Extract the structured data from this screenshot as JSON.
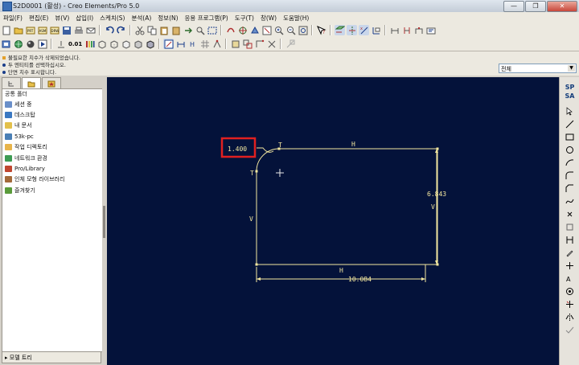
{
  "window": {
    "title": "S2D0001 (활성) - Creo Elements/Pro 5.0",
    "buttons": [
      "—",
      "❐",
      "✕"
    ]
  },
  "menu": [
    "파일(F)",
    "편집(E)",
    "뷰(V)",
    "삽입(I)",
    "스케치(S)",
    "분석(A)",
    "정보(N)",
    "응용 프로그램(P)",
    "도구(T)",
    "창(W)",
    "도움말(H)"
  ],
  "toolbar": {
    "dim_label": "0.01"
  },
  "messages": [
    "불필요한 치수가 삭제되었습니다.",
    "두 엔티티를 선택하십시오.",
    "단면 치수 표시합니다."
  ],
  "filter": {
    "value": "전체"
  },
  "folders": {
    "header": "공통 폴더",
    "items": [
      {
        "label": "세션 중",
        "icon": "session-icon",
        "color": "#6a8fc9"
      },
      {
        "label": "데스크탑",
        "icon": "desktop-icon",
        "color": "#3a78c2"
      },
      {
        "label": "내 문서",
        "icon": "documents-icon",
        "color": "#e3c04a"
      },
      {
        "label": "53k-pc",
        "icon": "computer-icon",
        "color": "#4a7fb5"
      },
      {
        "label": "작업 디렉토리",
        "icon": "working-dir-icon",
        "color": "#e8b44a"
      },
      {
        "label": "네트워크 환경",
        "icon": "network-icon",
        "color": "#3e9b54"
      },
      {
        "label": "Pro/Library",
        "icon": "library-icon",
        "color": "#c0462f"
      },
      {
        "label": "인체 모형 라이브러리",
        "icon": "manikin-icon",
        "color": "#a36a3a"
      },
      {
        "label": "즐겨찾기",
        "icon": "favorites-icon",
        "color": "#5a9b3a"
      }
    ]
  },
  "model_tree_label": "모델 트리",
  "right_toolbar": {
    "sp": "SP",
    "sa": "SA"
  },
  "sketch": {
    "dimensions": {
      "radius": "1.400",
      "height": "6.843",
      "width": "10.084"
    },
    "constraints": {
      "tangent": "T",
      "horizontal": "H",
      "vertical": "V"
    }
  },
  "colors": {
    "canvas": "#04123a",
    "geometry": "#f4e8a0",
    "highlight": "#e02020"
  }
}
